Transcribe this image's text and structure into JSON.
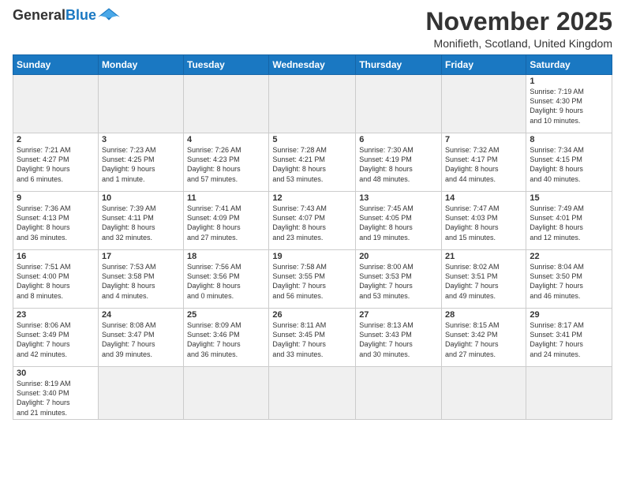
{
  "logo": {
    "general": "General",
    "blue": "Blue"
  },
  "header": {
    "month": "November 2025",
    "location": "Monifieth, Scotland, United Kingdom"
  },
  "weekdays": [
    "Sunday",
    "Monday",
    "Tuesday",
    "Wednesday",
    "Thursday",
    "Friday",
    "Saturday"
  ],
  "weeks": [
    [
      {
        "day": "",
        "info": "",
        "empty": true
      },
      {
        "day": "",
        "info": "",
        "empty": true
      },
      {
        "day": "",
        "info": "",
        "empty": true
      },
      {
        "day": "",
        "info": "",
        "empty": true
      },
      {
        "day": "",
        "info": "",
        "empty": true
      },
      {
        "day": "",
        "info": "",
        "empty": true
      },
      {
        "day": "1",
        "info": "Sunrise: 7:19 AM\nSunset: 4:30 PM\nDaylight: 9 hours\nand 10 minutes."
      }
    ],
    [
      {
        "day": "2",
        "info": "Sunrise: 7:21 AM\nSunset: 4:27 PM\nDaylight: 9 hours\nand 6 minutes."
      },
      {
        "day": "3",
        "info": "Sunrise: 7:23 AM\nSunset: 4:25 PM\nDaylight: 9 hours\nand 1 minute."
      },
      {
        "day": "4",
        "info": "Sunrise: 7:26 AM\nSunset: 4:23 PM\nDaylight: 8 hours\nand 57 minutes."
      },
      {
        "day": "5",
        "info": "Sunrise: 7:28 AM\nSunset: 4:21 PM\nDaylight: 8 hours\nand 53 minutes."
      },
      {
        "day": "6",
        "info": "Sunrise: 7:30 AM\nSunset: 4:19 PM\nDaylight: 8 hours\nand 48 minutes."
      },
      {
        "day": "7",
        "info": "Sunrise: 7:32 AM\nSunset: 4:17 PM\nDaylight: 8 hours\nand 44 minutes."
      },
      {
        "day": "8",
        "info": "Sunrise: 7:34 AM\nSunset: 4:15 PM\nDaylight: 8 hours\nand 40 minutes."
      }
    ],
    [
      {
        "day": "9",
        "info": "Sunrise: 7:36 AM\nSunset: 4:13 PM\nDaylight: 8 hours\nand 36 minutes."
      },
      {
        "day": "10",
        "info": "Sunrise: 7:39 AM\nSunset: 4:11 PM\nDaylight: 8 hours\nand 32 minutes."
      },
      {
        "day": "11",
        "info": "Sunrise: 7:41 AM\nSunset: 4:09 PM\nDaylight: 8 hours\nand 27 minutes."
      },
      {
        "day": "12",
        "info": "Sunrise: 7:43 AM\nSunset: 4:07 PM\nDaylight: 8 hours\nand 23 minutes."
      },
      {
        "day": "13",
        "info": "Sunrise: 7:45 AM\nSunset: 4:05 PM\nDaylight: 8 hours\nand 19 minutes."
      },
      {
        "day": "14",
        "info": "Sunrise: 7:47 AM\nSunset: 4:03 PM\nDaylight: 8 hours\nand 15 minutes."
      },
      {
        "day": "15",
        "info": "Sunrise: 7:49 AM\nSunset: 4:01 PM\nDaylight: 8 hours\nand 12 minutes."
      }
    ],
    [
      {
        "day": "16",
        "info": "Sunrise: 7:51 AM\nSunset: 4:00 PM\nDaylight: 8 hours\nand 8 minutes."
      },
      {
        "day": "17",
        "info": "Sunrise: 7:53 AM\nSunset: 3:58 PM\nDaylight: 8 hours\nand 4 minutes."
      },
      {
        "day": "18",
        "info": "Sunrise: 7:56 AM\nSunset: 3:56 PM\nDaylight: 8 hours\nand 0 minutes."
      },
      {
        "day": "19",
        "info": "Sunrise: 7:58 AM\nSunset: 3:55 PM\nDaylight: 7 hours\nand 56 minutes."
      },
      {
        "day": "20",
        "info": "Sunrise: 8:00 AM\nSunset: 3:53 PM\nDaylight: 7 hours\nand 53 minutes."
      },
      {
        "day": "21",
        "info": "Sunrise: 8:02 AM\nSunset: 3:51 PM\nDaylight: 7 hours\nand 49 minutes."
      },
      {
        "day": "22",
        "info": "Sunrise: 8:04 AM\nSunset: 3:50 PM\nDaylight: 7 hours\nand 46 minutes."
      }
    ],
    [
      {
        "day": "23",
        "info": "Sunrise: 8:06 AM\nSunset: 3:49 PM\nDaylight: 7 hours\nand 42 minutes."
      },
      {
        "day": "24",
        "info": "Sunrise: 8:08 AM\nSunset: 3:47 PM\nDaylight: 7 hours\nand 39 minutes."
      },
      {
        "day": "25",
        "info": "Sunrise: 8:09 AM\nSunset: 3:46 PM\nDaylight: 7 hours\nand 36 minutes."
      },
      {
        "day": "26",
        "info": "Sunrise: 8:11 AM\nSunset: 3:45 PM\nDaylight: 7 hours\nand 33 minutes."
      },
      {
        "day": "27",
        "info": "Sunrise: 8:13 AM\nSunset: 3:43 PM\nDaylight: 7 hours\nand 30 minutes."
      },
      {
        "day": "28",
        "info": "Sunrise: 8:15 AM\nSunset: 3:42 PM\nDaylight: 7 hours\nand 27 minutes."
      },
      {
        "day": "29",
        "info": "Sunrise: 8:17 AM\nSunset: 3:41 PM\nDaylight: 7 hours\nand 24 minutes."
      }
    ],
    [
      {
        "day": "30",
        "info": "Sunrise: 8:19 AM\nSunset: 3:40 PM\nDaylight: 7 hours\nand 21 minutes."
      },
      {
        "day": "",
        "info": "",
        "empty": true
      },
      {
        "day": "",
        "info": "",
        "empty": true
      },
      {
        "day": "",
        "info": "",
        "empty": true
      },
      {
        "day": "",
        "info": "",
        "empty": true
      },
      {
        "day": "",
        "info": "",
        "empty": true
      },
      {
        "day": "",
        "info": "",
        "empty": true
      }
    ]
  ]
}
